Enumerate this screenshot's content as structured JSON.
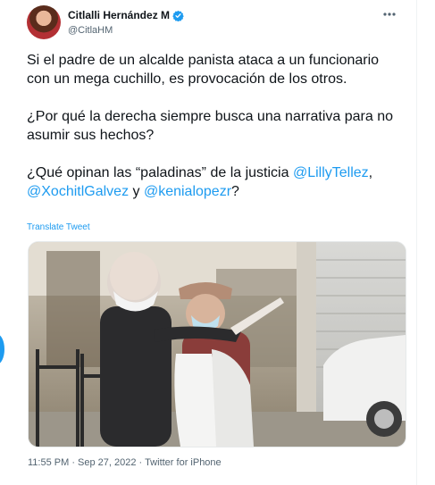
{
  "author": {
    "display_name": "Citlalli Hernández M",
    "handle": "@CitlaHM",
    "verified": true
  },
  "tweet": {
    "paragraphs": [
      [
        {
          "text": "Si el padre de un alcalde panista ataca a un funcionario con un mega cuchillo, es provocación de los otros.",
          "mention": false
        }
      ],
      [
        {
          "text": "¿Por qué la derecha siempre busca una narrativa para no asumir sus hechos?",
          "mention": false
        }
      ],
      [
        {
          "text": "¿Qué opinan las “paladinas” de la justicia ",
          "mention": false
        },
        {
          "text": "@LillyTellez",
          "mention": true
        },
        {
          "text": ", ",
          "mention": false
        },
        {
          "text": "@XochitlGalvez",
          "mention": true
        },
        {
          "text": " y ",
          "mention": false
        },
        {
          "text": "@kenialopezr",
          "mention": true
        },
        {
          "text": "?",
          "mention": false
        }
      ]
    ],
    "translate_label": "Translate Tweet",
    "timestamp": "11:55 PM · Sep 27, 2022 · Twitter for iPhone"
  },
  "colors": {
    "link": "#1d9bf0",
    "secondary_text": "#536471",
    "primary_text": "#0f1419"
  },
  "icons": [
    "verified-badge-icon",
    "more-options-icon"
  ]
}
